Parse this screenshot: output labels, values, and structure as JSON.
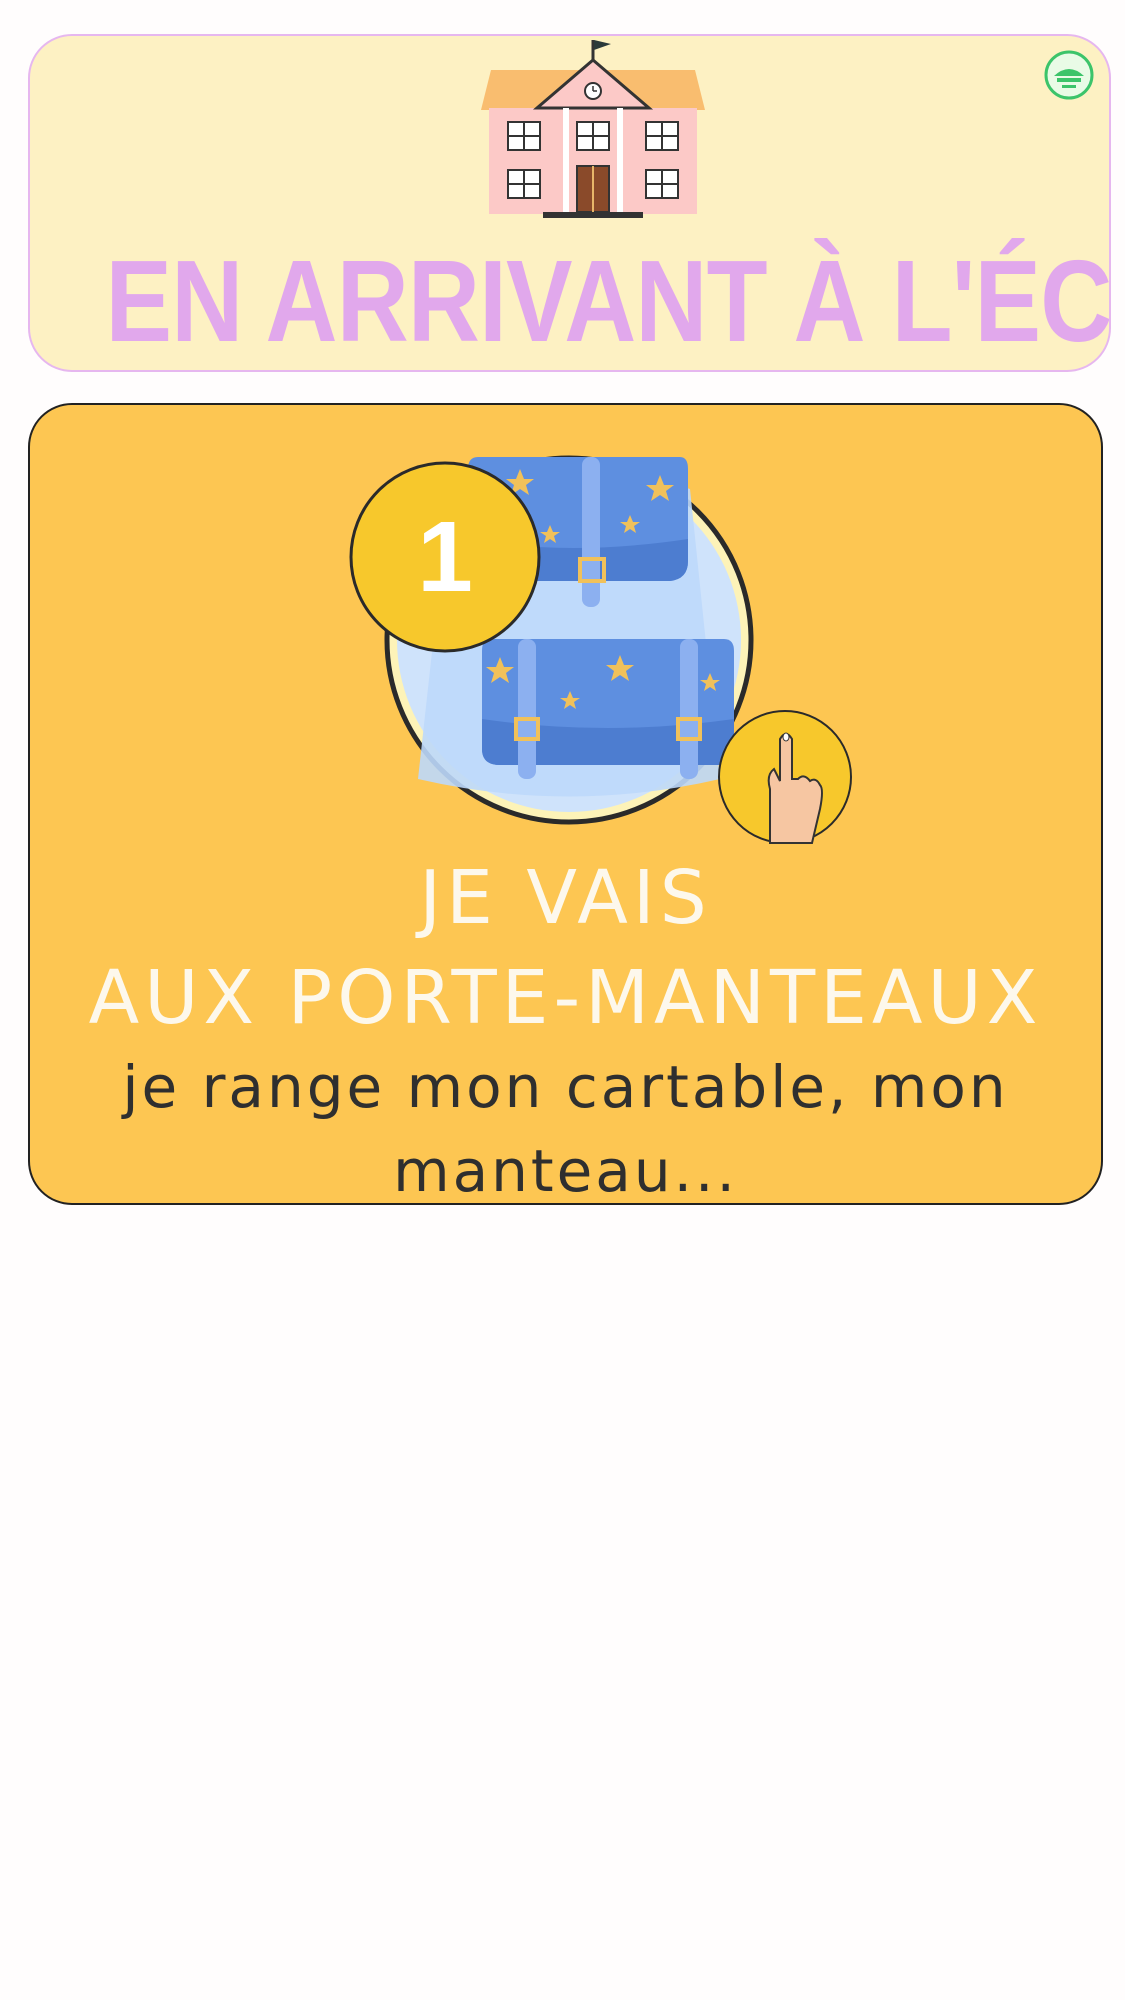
{
  "header": {
    "title": "EN ARRIVANT À L'ÉCOLE",
    "illustration_icon": "school-building-icon",
    "logo_icon": "circular-badge-logo-icon",
    "title_color": "#e1a8ec",
    "background_color": "#fdf1c3"
  },
  "card": {
    "step_number": "1",
    "heading_line_1": "JE VAIS",
    "heading_line_2": "AUX PORTE-MANTEAUX",
    "body": "je range mon cartable, mon manteau...",
    "illustration_icon": "backpack-icon",
    "pointer_icon": "pointing-hand-icon",
    "background_color": "#fdc652",
    "badge_color": "#f7c82c"
  }
}
